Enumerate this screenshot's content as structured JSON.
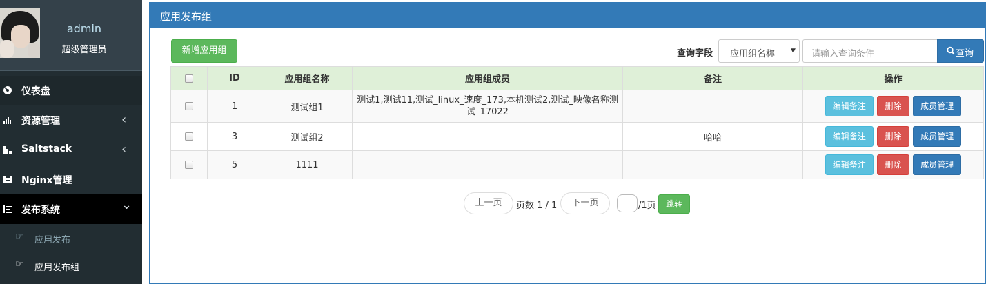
{
  "sidebar": {
    "user": {
      "name": "admin",
      "role": "超级管理员"
    },
    "items": [
      {
        "label": "仪表盘",
        "icon": "dashboard-icon"
      },
      {
        "label": "资源管理",
        "icon": "resource-icon",
        "chevron": "‹"
      },
      {
        "label": "Saltstack",
        "icon": "saltstack-icon",
        "chevron": "‹"
      },
      {
        "label": "Nginx管理",
        "icon": "nginx-icon"
      },
      {
        "label": "发布系统",
        "icon": "publish-icon",
        "chevron": "⌄"
      }
    ],
    "subitems": [
      {
        "label": "应用发布",
        "icon": "hand-pointer-icon"
      },
      {
        "label": "应用发布组",
        "icon": "hand-pointer-icon"
      }
    ]
  },
  "panel": {
    "title": "应用发布组"
  },
  "toolbar": {
    "add_label": "新增应用组",
    "query_label": "查询字段",
    "select_value": "应用组名称",
    "input_placeholder": "请输入查询条件",
    "search_label": "查询"
  },
  "table": {
    "headers": [
      "",
      "ID",
      "应用组名称",
      "应用组成员",
      "备注",
      "操作"
    ],
    "rows": [
      {
        "id": "1",
        "name": "测试组1",
        "members": "测试1,测试11,测试_linux_速度_173,本机测试2,测试_映像名称测试_17022",
        "note": ""
      },
      {
        "id": "3",
        "name": "测试组2",
        "members": "",
        "note": "哈哈"
      },
      {
        "id": "5",
        "name": "1111",
        "members": "",
        "note": ""
      }
    ],
    "actions": {
      "edit": "编辑备注",
      "delete": "删除",
      "members": "成员管理"
    }
  },
  "pager": {
    "prev": "上一页",
    "page_info": "页数 1 / 1",
    "next": "下一页",
    "total_suffix": "/1页",
    "go": "跳转"
  },
  "colors": {
    "sidebar_bg": "#222d32",
    "primary": "#337ab7",
    "success": "#5cb85c",
    "info": "#5bc0de",
    "danger": "#d9534f",
    "table_header": "#dff0d8"
  }
}
